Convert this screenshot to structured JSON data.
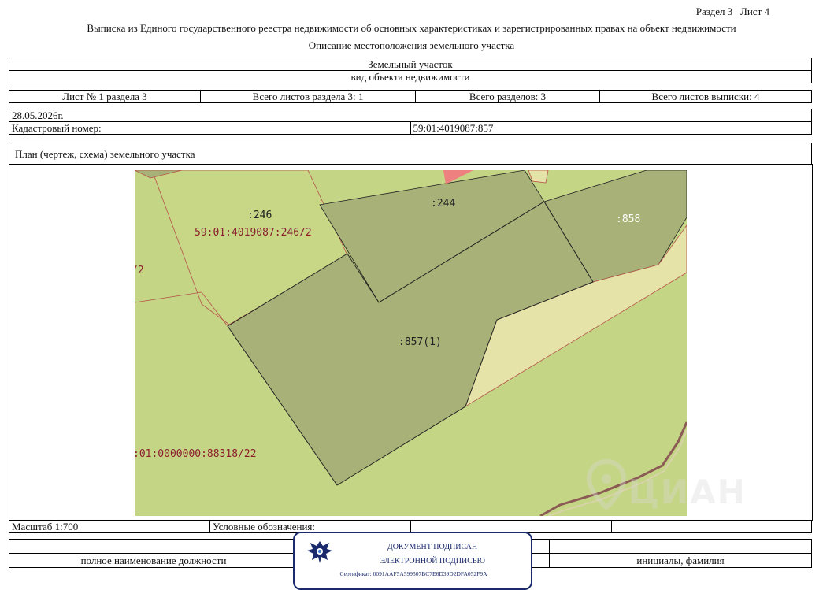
{
  "header": {
    "section_sheet": "Раздел 3   Лист 4",
    "title": "Выписка из Единого государственного реестра недвижимости об основных характеристиках и зарегистрированных правах на объект недвижимости",
    "subtitle": "Описание местоположения земельного участка"
  },
  "object": {
    "type": "Земельный участок",
    "caption": "вид объекта недвижимости"
  },
  "sheet_info": {
    "sheet": "Лист № 1 раздела 3",
    "total_section_sheets": "Всего листов раздела 3: 1",
    "total_sections": "Всего разделов: 3",
    "total_extract_sheets": "Всего листов выписки: 4"
  },
  "record": {
    "date": "28.05.2026г.",
    "cadastral_label": "Кадастровый номер:",
    "cadastral_number": "59:01:4019087:857"
  },
  "plan": {
    "title": "План (чертеж, схема) земельного участка",
    "labels": {
      "p246": ":246",
      "p246_full": "59:01:4019087:246/2",
      "p246_frag": "/2",
      "p244": ":244",
      "p858": ":858",
      "p857": ":857(1)",
      "p88318": ":01:0000000:88318/22"
    },
    "colors": {
      "light_green": "#c4d686",
      "dark_olive": "#a8b177",
      "pale_yellow": "#e6e3a8",
      "boundary_red": "#b5524a",
      "label_red": "#8a1f2e",
      "road": "#8c5a55"
    }
  },
  "footer": {
    "scale": "Масштаб 1:700",
    "legend_label": "Условные обозначения:",
    "position_caption": "полное наименование должности",
    "initials_caption": "инициалы, фамилия"
  },
  "stamp": {
    "line1": "ДОКУМЕНТ ПОДПИСАН",
    "line2": "ЭЛЕКТРОННОЙ ПОДПИСЬЮ",
    "certificate": "Сертификат: 0091AAF5A599507BC7E6D39D2DFA052F9A",
    "color": "#1a2a6c"
  },
  "watermark": {
    "text": "ЦИАН",
    "icon": "location-pin-icon"
  }
}
